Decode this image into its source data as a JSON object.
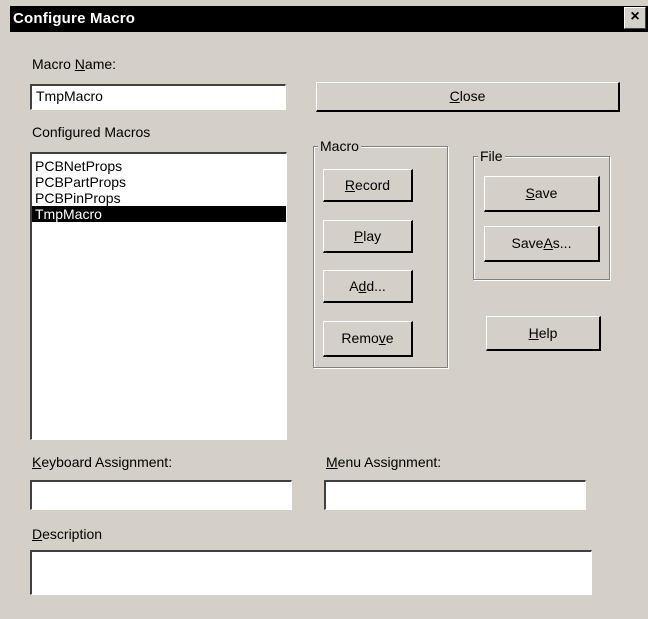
{
  "window": {
    "title": "Configure Macro",
    "close_glyph": "×"
  },
  "macro_name": {
    "label_pre": "Macro ",
    "label_acc": "N",
    "label_post": "ame:",
    "value": "TmpMacro"
  },
  "close_button": {
    "pre": "",
    "acc": "C",
    "post": "lose"
  },
  "configured_macros": {
    "label": "Configured Macros",
    "items": [
      "PCBNetProps",
      "PCBPartProps",
      "PCBPinProps",
      "TmpMacro"
    ],
    "selected_index": 3
  },
  "macro_group": {
    "legend": "Macro",
    "record": {
      "pre": "",
      "acc": "R",
      "post": "ecord"
    },
    "play": {
      "pre": "",
      "acc": "P",
      "post": "lay"
    },
    "add": {
      "pre": "A",
      "acc": "d",
      "post": "d..."
    },
    "remove": {
      "pre": "Remo",
      "acc": "v",
      "post": "e"
    }
  },
  "file_group": {
    "legend": "File",
    "save": {
      "pre": "",
      "acc": "S",
      "post": "ave"
    },
    "save_as": {
      "pre": "Save ",
      "acc": "A",
      "post": "s..."
    }
  },
  "help_button": {
    "pre": "",
    "acc": "H",
    "post": "elp"
  },
  "keyboard_assignment": {
    "label_pre": "",
    "label_acc": "K",
    "label_post": "eyboard Assignment:",
    "value": ""
  },
  "menu_assignment": {
    "label_pre": "",
    "label_acc": "M",
    "label_post": "enu Assignment:",
    "value": ""
  },
  "description": {
    "label_pre": "",
    "label_acc": "D",
    "label_post": "escription",
    "value": ""
  }
}
